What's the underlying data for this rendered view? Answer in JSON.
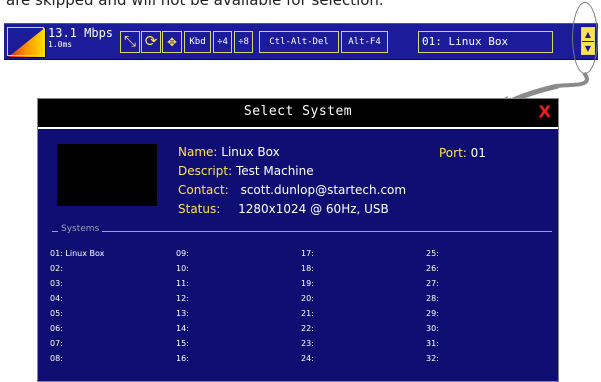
{
  "top_text": "are skipped and will not be available for selection.",
  "toolbar": {
    "rate_main": "13.1 Mbps",
    "rate_sub": "1.0ms",
    "scale_icon": "⤡",
    "refresh_icon": "⟳",
    "move_icon": "✥",
    "kbd_label": "Kbd",
    "div4_label": "÷4",
    "div8_label": "÷8",
    "ctl_alt_del_label": "Ctl-Alt-Del",
    "alt_f4_label": "Alt-F4",
    "selected_system": "01: Linux Box",
    "arrow_up": "▲",
    "arrow_down": "▼"
  },
  "dialog": {
    "title": "Select System",
    "close": "X",
    "name_label": "Name:",
    "name_value": "Linux Box",
    "descript_label": "Descript:",
    "descript_value": "Test Machine",
    "contact_label": "Contact:",
    "contact_value": "scott.dunlop@startech.com",
    "status_label": "Status:",
    "status_value": "1280x1024 @ 60Hz, USB",
    "port_label": "Port:",
    "port_value": "01",
    "systems_label": "Systems",
    "systems": [
      "01: Linux Box",
      "02:",
      "03:",
      "04:",
      "05:",
      "06:",
      "07:",
      "08:",
      "09:",
      "10:",
      "11:",
      "12:",
      "13:",
      "14:",
      "15:",
      "16:",
      "17:",
      "18:",
      "19:",
      "20:",
      "21:",
      "22:",
      "23:",
      "24:",
      "25:",
      "26:",
      "27:",
      "28:",
      "29:",
      "30:",
      "31:",
      "32:"
    ]
  },
  "colors": {
    "toolbar_bg": "#1c1c9a",
    "dialog_bg": "#0f0f73",
    "accent_yellow": "#ffe34d",
    "close_red": "#ff1a1a"
  }
}
